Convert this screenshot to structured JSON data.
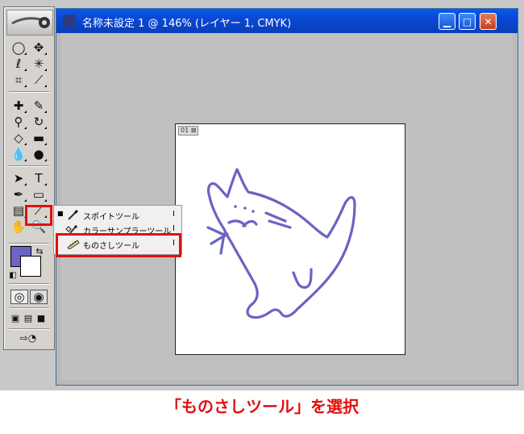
{
  "window": {
    "title": "名称未設定 1 @ 146% (レイヤー 1, CMYK)",
    "canvas_tag": "01 ⊠",
    "min_label": "▁",
    "max_label": "□",
    "close_label": "✕"
  },
  "toolbox": {
    "tools": [
      {
        "name": "marquee-tool",
        "glyph": "◯"
      },
      {
        "name": "move-tool",
        "glyph": "✥"
      },
      {
        "name": "lasso-tool",
        "glyph": "ℓ"
      },
      {
        "name": "magic-wand-tool",
        "glyph": "✳"
      },
      {
        "name": "crop-tool",
        "glyph": "⌗"
      },
      {
        "name": "slice-tool",
        "glyph": "⟋"
      },
      {
        "name": "healing-brush-tool",
        "glyph": "✚"
      },
      {
        "name": "brush-tool",
        "glyph": "✎"
      },
      {
        "name": "stamp-tool",
        "glyph": "⚲"
      },
      {
        "name": "history-brush-tool",
        "glyph": "↻"
      },
      {
        "name": "eraser-tool",
        "glyph": "◇"
      },
      {
        "name": "gradient-tool",
        "glyph": "▬"
      },
      {
        "name": "blur-tool",
        "glyph": "💧"
      },
      {
        "name": "dodge-tool",
        "glyph": "●"
      },
      {
        "name": "path-select-tool",
        "glyph": "➤"
      },
      {
        "name": "type-tool",
        "glyph": "T"
      },
      {
        "name": "pen-tool",
        "glyph": "✒"
      },
      {
        "name": "shape-tool",
        "glyph": "▭"
      },
      {
        "name": "notes-tool",
        "glyph": "▤"
      },
      {
        "name": "eyedropper-tool",
        "glyph": "⟋"
      },
      {
        "name": "hand-tool",
        "glyph": "✋"
      },
      {
        "name": "zoom-tool",
        "glyph": "🔍"
      }
    ]
  },
  "flyout": {
    "items": [
      {
        "label": "スポイトツール",
        "key": "I",
        "active": true
      },
      {
        "label": "カラーサンプラーツール",
        "key": "I",
        "active": false
      },
      {
        "label": "ものさしツール",
        "key": "I",
        "active": false
      }
    ]
  },
  "caption": "「ものさしツール」を選択",
  "colors": {
    "foreground": "#6c64c6",
    "background": "#ffffff",
    "highlight": "#e01010",
    "stroke": "#6a64c0"
  }
}
